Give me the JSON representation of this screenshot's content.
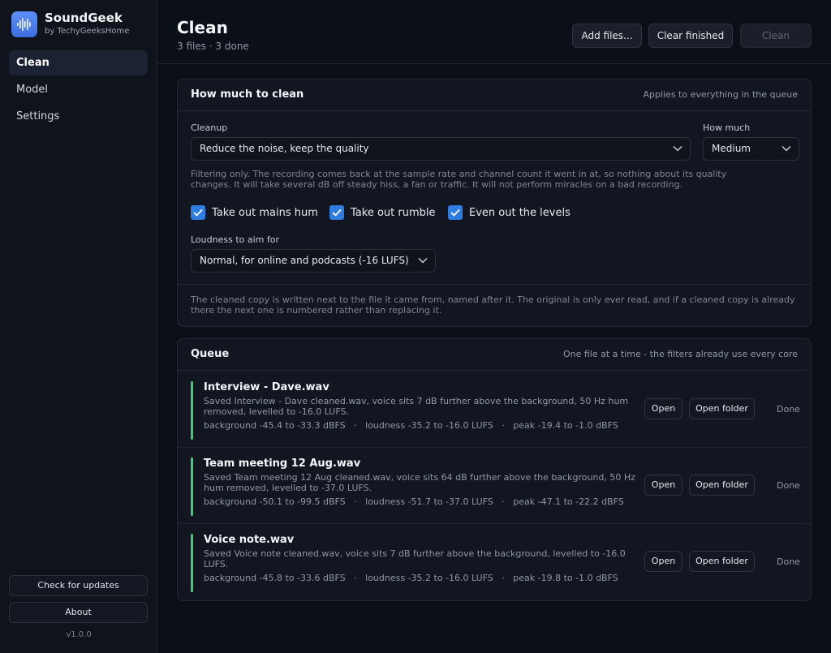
{
  "app": {
    "name": "SoundGeek",
    "subtitle": "by TechyGeeksHome",
    "logo_icon": "waveform-icon",
    "version": "v1.0.0"
  },
  "sidebar": {
    "items": [
      {
        "label": "Clean",
        "active": true
      },
      {
        "label": "Model",
        "active": false
      },
      {
        "label": "Settings",
        "active": false
      }
    ],
    "check_updates_label": "Check for updates",
    "about_label": "About"
  },
  "header": {
    "title": "Clean",
    "subtitle": "3 files · 3 done",
    "add_files_label": "Add files...",
    "clear_finished_label": "Clear finished",
    "clean_label": "Clean"
  },
  "settings_card": {
    "title": "How much to clean",
    "note": "Applies to everything in the queue",
    "cleanup_label": "Cleanup",
    "cleanup_value": "Reduce the noise, keep the quality",
    "how_much_label": "How much",
    "how_much_value": "Medium",
    "helper_line1": "Filtering only. The recording comes back at the sample rate and channel count it went in at, so nothing about its quality",
    "helper_line2": "changes. It will take several dB off steady hiss, a fan or traffic. It will not perform miracles on a bad recording.",
    "checkboxes": [
      {
        "label": "Take out mains hum",
        "checked": true
      },
      {
        "label": "Take out rumble",
        "checked": true
      },
      {
        "label": "Even out the levels",
        "checked": true
      }
    ],
    "loudness_label": "Loudness to aim for",
    "loudness_value": "Normal, for online and podcasts (-16 LUFS)",
    "footer_line1": "The cleaned copy is written next to the file it came from, named after it. The original is only ever read, and if a cleaned copy is already",
    "footer_line2": "there the next one is numbered rather than replacing it."
  },
  "queue_card": {
    "title": "Queue",
    "note": "One file at a time - the filters already use every core",
    "open_label": "Open",
    "open_folder_label": "Open folder",
    "items": [
      {
        "title": "Interview - Dave.wav",
        "desc_line1": "Saved Interview - Dave cleaned.wav, voice sits 7 dB further above the background, 50 Hz hum",
        "desc_line2": "removed, levelled to -16.0 LUFS.",
        "stats": "background -45.4 to -33.3 dBFS   ·   loudness -35.2 to -16.0 LUFS   ·   peak -19.4 to -1.0 dBFS",
        "status": "Done",
        "status_color": "#3ecf74"
      },
      {
        "title": "Team meeting 12 Aug.wav",
        "desc_line1": "Saved Team meeting 12 Aug cleaned.wav, voice sits 64 dB further above the background, 50 Hz",
        "desc_line2": "hum removed, levelled to -37.0 LUFS.",
        "stats": "background -50.1 to -99.5 dBFS   ·   loudness -51.7 to -37.0 LUFS   ·   peak -47.1 to -22.2 dBFS",
        "status": "Done",
        "status_color": "#3ecf74"
      },
      {
        "title": "Voice note.wav",
        "desc_line1": "Saved Voice note cleaned.wav, voice sits 7 dB further above the background, levelled to -16.0",
        "desc_line2": "LUFS.",
        "stats": "background -45.8 to -33.6 dBFS   ·   loudness -35.2 to -16.0 LUFS   ·   peak -19.8 to -1.0 dBFS",
        "status": "Done",
        "status_color": "#3ecf74"
      }
    ]
  },
  "colors": {
    "accent": "#2f7de1",
    "done": "#3ecf74",
    "background": "#0b0f17"
  }
}
